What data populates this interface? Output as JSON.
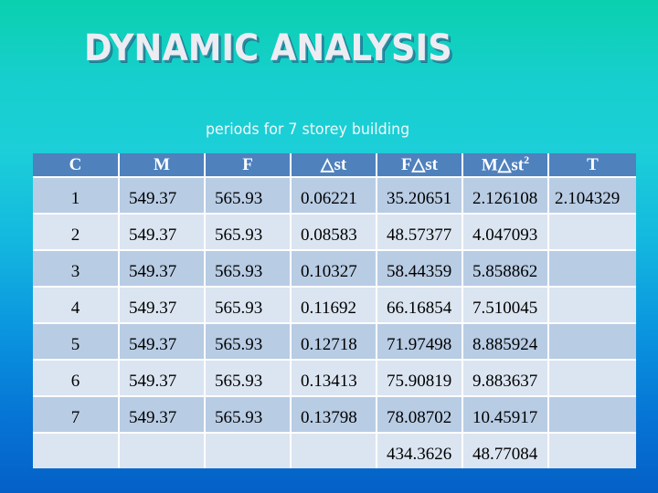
{
  "slide": {
    "title": "DYNAMIC ANALYSIS",
    "subtitle": "periods for 7 storey building"
  },
  "table": {
    "headers": {
      "c": "C",
      "m": "M",
      "f": "F",
      "dst": "△st",
      "fdst": "F△st",
      "mdst2_base": "M△st",
      "mdst2_sup": "2",
      "t": "T"
    },
    "rows": [
      {
        "c": "1",
        "m": "549.37",
        "f": "565.93",
        "dst": "0.06221",
        "fdst": "35.20651",
        "mdst2": "2.126108",
        "t": "2.104329"
      },
      {
        "c": "2",
        "m": "549.37",
        "f": "565.93",
        "dst": "0.08583",
        "fdst": "48.57377",
        "mdst2": "4.047093",
        "t": ""
      },
      {
        "c": "3",
        "m": "549.37",
        "f": "565.93",
        "dst": "0.10327",
        "fdst": "58.44359",
        "mdst2": "5.858862",
        "t": ""
      },
      {
        "c": "4",
        "m": "549.37",
        "f": "565.93",
        "dst": "0.11692",
        "fdst": "66.16854",
        "mdst2": "7.510045",
        "t": ""
      },
      {
        "c": "5",
        "m": "549.37",
        "f": "565.93",
        "dst": "0.12718",
        "fdst": "71.97498",
        "mdst2": "8.885924",
        "t": ""
      },
      {
        "c": "6",
        "m": "549.37",
        "f": "565.93",
        "dst": "0.13413",
        "fdst": "75.90819",
        "mdst2": "9.883637",
        "t": ""
      },
      {
        "c": "7",
        "m": "549.37",
        "f": "565.93",
        "dst": "0.13798",
        "fdst": "78.08702",
        "mdst2": "10.45917",
        "t": ""
      }
    ],
    "totals": {
      "c": "",
      "m": "",
      "f": "",
      "dst": "",
      "fdst": "434.3626",
      "mdst2": "48.77084",
      "t": ""
    }
  },
  "colors": {
    "header_bg": "#4f81bd",
    "row_odd_bg": "#b8cce4",
    "row_even_bg": "#dbe5f1",
    "title_text": "#ececf2"
  }
}
